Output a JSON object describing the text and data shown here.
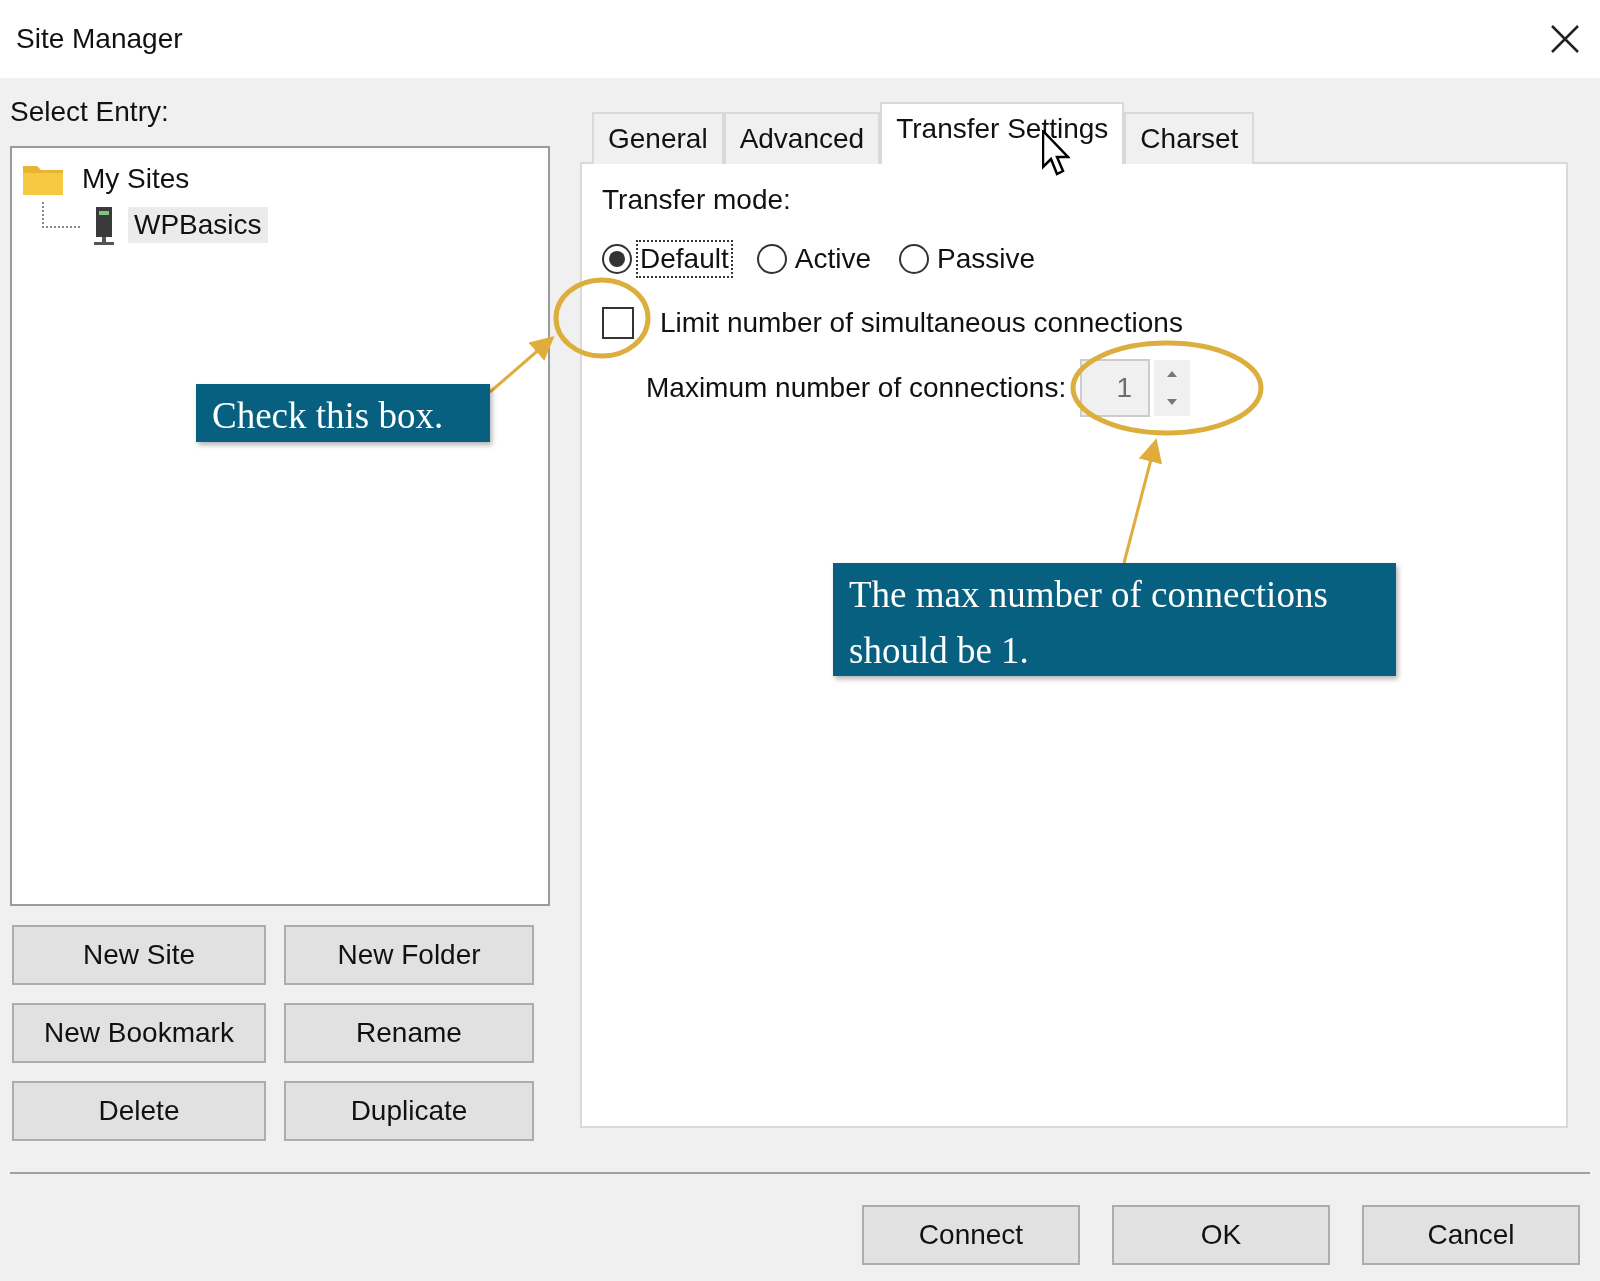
{
  "window": {
    "title": "Site Manager"
  },
  "select_entry_label": "Select Entry:",
  "tree": [
    {
      "label": "My Sites",
      "selected": false,
      "children": [
        {
          "label": "WPBasics",
          "selected": true
        }
      ]
    }
  ],
  "site_buttons": [
    "New Site",
    "New Folder",
    "New Bookmark",
    "Rename",
    "Delete",
    "Duplicate"
  ],
  "tabs": [
    {
      "label": "General",
      "selected": false
    },
    {
      "label": "Advanced",
      "selected": false
    },
    {
      "label": "Transfer Settings",
      "selected": true
    },
    {
      "label": "Charset",
      "selected": false
    }
  ],
  "transfer_mode": {
    "label": "Transfer mode:",
    "options": [
      {
        "label": "Default",
        "selected": true
      },
      {
        "label": "Active",
        "selected": false
      },
      {
        "label": "Passive",
        "selected": false
      }
    ]
  },
  "limit_connections": {
    "label": "Limit number of simultaneous connections",
    "checked": false
  },
  "max_connections": {
    "label": "Maximum number of connections:",
    "value": "1",
    "disabled": true
  },
  "annotations": [
    {
      "text": "Check this box."
    },
    {
      "text": "The max number of connections should be 1."
    }
  ],
  "dialog_buttons": [
    "Connect",
    "OK",
    "Cancel"
  ]
}
